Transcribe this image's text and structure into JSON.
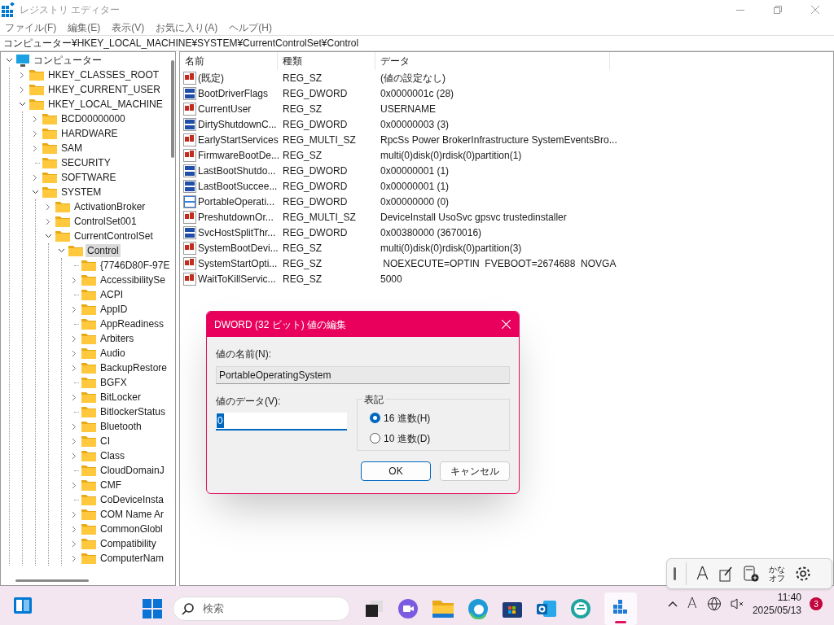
{
  "window": {
    "title": "レジストリ エディター"
  },
  "menu": [
    "ファイル(F)",
    "編集(E)",
    "表示(V)",
    "お気に入り(A)",
    "ヘルプ(H)"
  ],
  "address": "コンピューター¥HKEY_LOCAL_MACHINE¥SYSTEM¥CurrentControlSet¥Control",
  "tree": [
    {
      "label": "コンピューター",
      "kind": "root",
      "selected": false,
      "children": [
        {
          "label": "HKEY_CLASSES_ROOT",
          "kind": "collapsed",
          "selected": false
        },
        {
          "label": "HKEY_CURRENT_USER",
          "kind": "collapsed",
          "selected": false
        },
        {
          "label": "HKEY_LOCAL_MACHINE",
          "kind": "expanded",
          "selected": false,
          "children": [
            {
              "label": "BCD00000000",
              "kind": "collapsed",
              "selected": false
            },
            {
              "label": "HARDWARE",
              "kind": "collapsed",
              "selected": false
            },
            {
              "label": "SAM",
              "kind": "collapsed",
              "selected": false
            },
            {
              "label": "SECURITY",
              "kind": "leaf",
              "selected": false
            },
            {
              "label": "SOFTWARE",
              "kind": "collapsed",
              "selected": false
            },
            {
              "label": "SYSTEM",
              "kind": "expanded",
              "selected": false,
              "children": [
                {
                  "label": "ActivationBroker",
                  "kind": "collapsed",
                  "selected": false
                },
                {
                  "label": "ControlSet001",
                  "kind": "collapsed",
                  "selected": false
                },
                {
                  "label": "CurrentControlSet",
                  "kind": "expanded",
                  "selected": false,
                  "children": [
                    {
                      "label": "Control",
                      "kind": "expanded",
                      "selected": true,
                      "children": [
                        {
                          "label": "{7746D80F-97E",
                          "kind": "leaf",
                          "selected": false
                        },
                        {
                          "label": "AccessibilitySe",
                          "kind": "collapsed",
                          "selected": false
                        },
                        {
                          "label": "ACPI",
                          "kind": "leaf",
                          "selected": false
                        },
                        {
                          "label": "AppID",
                          "kind": "collapsed",
                          "selected": false
                        },
                        {
                          "label": "AppReadiness",
                          "kind": "leaf",
                          "selected": false
                        },
                        {
                          "label": "Arbiters",
                          "kind": "collapsed",
                          "selected": false
                        },
                        {
                          "label": "Audio",
                          "kind": "collapsed",
                          "selected": false
                        },
                        {
                          "label": "BackupRestore",
                          "kind": "collapsed",
                          "selected": false
                        },
                        {
                          "label": "BGFX",
                          "kind": "leaf",
                          "selected": false
                        },
                        {
                          "label": "BitLocker",
                          "kind": "collapsed",
                          "selected": false
                        },
                        {
                          "label": "BitlockerStatus",
                          "kind": "leaf",
                          "selected": false
                        },
                        {
                          "label": "Bluetooth",
                          "kind": "collapsed",
                          "selected": false
                        },
                        {
                          "label": "CI",
                          "kind": "collapsed",
                          "selected": false
                        },
                        {
                          "label": "Class",
                          "kind": "collapsed",
                          "selected": false
                        },
                        {
                          "label": "CloudDomainJ",
                          "kind": "leaf",
                          "selected": false
                        },
                        {
                          "label": "CMF",
                          "kind": "collapsed",
                          "selected": false
                        },
                        {
                          "label": "CoDeviceInsta",
                          "kind": "leaf",
                          "selected": false
                        },
                        {
                          "label": "COM Name Ar",
                          "kind": "collapsed",
                          "selected": false
                        },
                        {
                          "label": "CommonGlobl",
                          "kind": "collapsed",
                          "selected": false
                        },
                        {
                          "label": "Compatibility",
                          "kind": "collapsed",
                          "selected": false
                        },
                        {
                          "label": "ComputerNam",
                          "kind": "collapsed",
                          "selected": false
                        }
                      ]
                    }
                  ]
                }
              ]
            }
          ]
        }
      ]
    }
  ],
  "table": {
    "columns": [
      "名前",
      "種類",
      "データ"
    ],
    "rows": [
      {
        "kind": "sz",
        "selected": false,
        "name": "(既定)",
        "type": "REG_SZ",
        "data": "(値の設定なし)"
      },
      {
        "kind": "dword",
        "selected": false,
        "name": "BootDriverFlags",
        "type": "REG_DWORD",
        "data": "0x0000001c (28)"
      },
      {
        "kind": "sz",
        "selected": false,
        "name": "CurrentUser",
        "type": "REG_SZ",
        "data": "USERNAME"
      },
      {
        "kind": "dword",
        "selected": false,
        "name": "DirtyShutdownC...",
        "type": "REG_DWORD",
        "data": "0x00000003 (3)"
      },
      {
        "kind": "sz",
        "selected": false,
        "name": "EarlyStartServices",
        "type": "REG_MULTI_SZ",
        "data": "RpcSs Power BrokerInfrastructure SystemEventsBro..."
      },
      {
        "kind": "sz",
        "selected": false,
        "name": "FirmwareBootDe...",
        "type": "REG_SZ",
        "data": "multi(0)disk(0)rdisk(0)partition(1)"
      },
      {
        "kind": "dword",
        "selected": false,
        "name": "LastBootShutdo...",
        "type": "REG_DWORD",
        "data": "0x00000001 (1)"
      },
      {
        "kind": "dword",
        "selected": false,
        "name": "LastBootSuccee...",
        "type": "REG_DWORD",
        "data": "0x00000001 (1)"
      },
      {
        "kind": "dword",
        "selected": true,
        "name": "PortableOperati...",
        "type": "REG_DWORD",
        "data": "0x00000000 (0)"
      },
      {
        "kind": "sz",
        "selected": false,
        "name": "PreshutdownOr...",
        "type": "REG_MULTI_SZ",
        "data": "DeviceInstall UsoSvc gpsvc trustedinstaller"
      },
      {
        "kind": "dword",
        "selected": false,
        "name": "SvcHostSplitThr...",
        "type": "REG_DWORD",
        "data": "0x00380000 (3670016)"
      },
      {
        "kind": "sz",
        "selected": false,
        "name": "SystemBootDevi...",
        "type": "REG_SZ",
        "data": "multi(0)disk(0)rdisk(0)partition(3)"
      },
      {
        "kind": "sz",
        "selected": false,
        "name": "SystemStartOpti...",
        "type": "REG_SZ",
        "data": " NOEXECUTE=OPTIN  FVEBOOT=2674688  NOVGA"
      },
      {
        "kind": "sz",
        "selected": false,
        "name": "WaitToKillServic...",
        "type": "REG_SZ",
        "data": "5000"
      }
    ]
  },
  "dialog": {
    "title": "DWORD (32 ビット) 値の編集",
    "name_label": "値の名前(N):",
    "name_value": "PortableOperatingSystem",
    "data_label": "値のデータ(V):",
    "data_value": "0",
    "base_group": "表記",
    "bases": [
      {
        "label": "16 進数(H)",
        "selected": true
      },
      {
        "label": "10 進数(D)",
        "selected": false
      }
    ],
    "buttons": [
      "OK",
      "キャンセル"
    ]
  },
  "ime_toolbar": {
    "mode": "A",
    "kana": "かな",
    "off": "オフ"
  },
  "taskbar": {
    "search_placeholder": "検索",
    "tray_input": "A",
    "time": "11:40",
    "date": "2025/05/13",
    "notifications": "3"
  }
}
